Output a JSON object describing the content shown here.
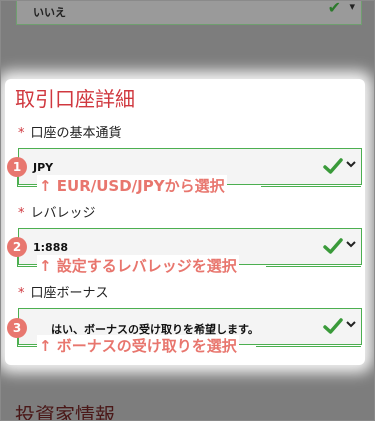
{
  "top_select": {
    "value": "いいえ"
  },
  "section": {
    "title": "取引口座詳細"
  },
  "fields": [
    {
      "required_mark": "*",
      "label": "口座の基本通貨",
      "value": "JPY",
      "step": "1",
      "hint": "↑ EUR/USD/JPYから選択"
    },
    {
      "required_mark": "*",
      "label": "レバレッジ",
      "value": "1:888",
      "step": "2",
      "hint": "↑ 設定するレバレッジを選択"
    },
    {
      "required_mark": "*",
      "label": "口座ボーナス",
      "value": "はい、ボーナスの受け取りを希望します。",
      "step": "3",
      "hint": "↑ ボーナスの受け取りを選択"
    }
  ],
  "next_section": {
    "title": "投資家情報"
  },
  "colors": {
    "accent_red": "#d0383f",
    "valid_green": "#4caf50",
    "hint_pink": "#e8766e"
  }
}
